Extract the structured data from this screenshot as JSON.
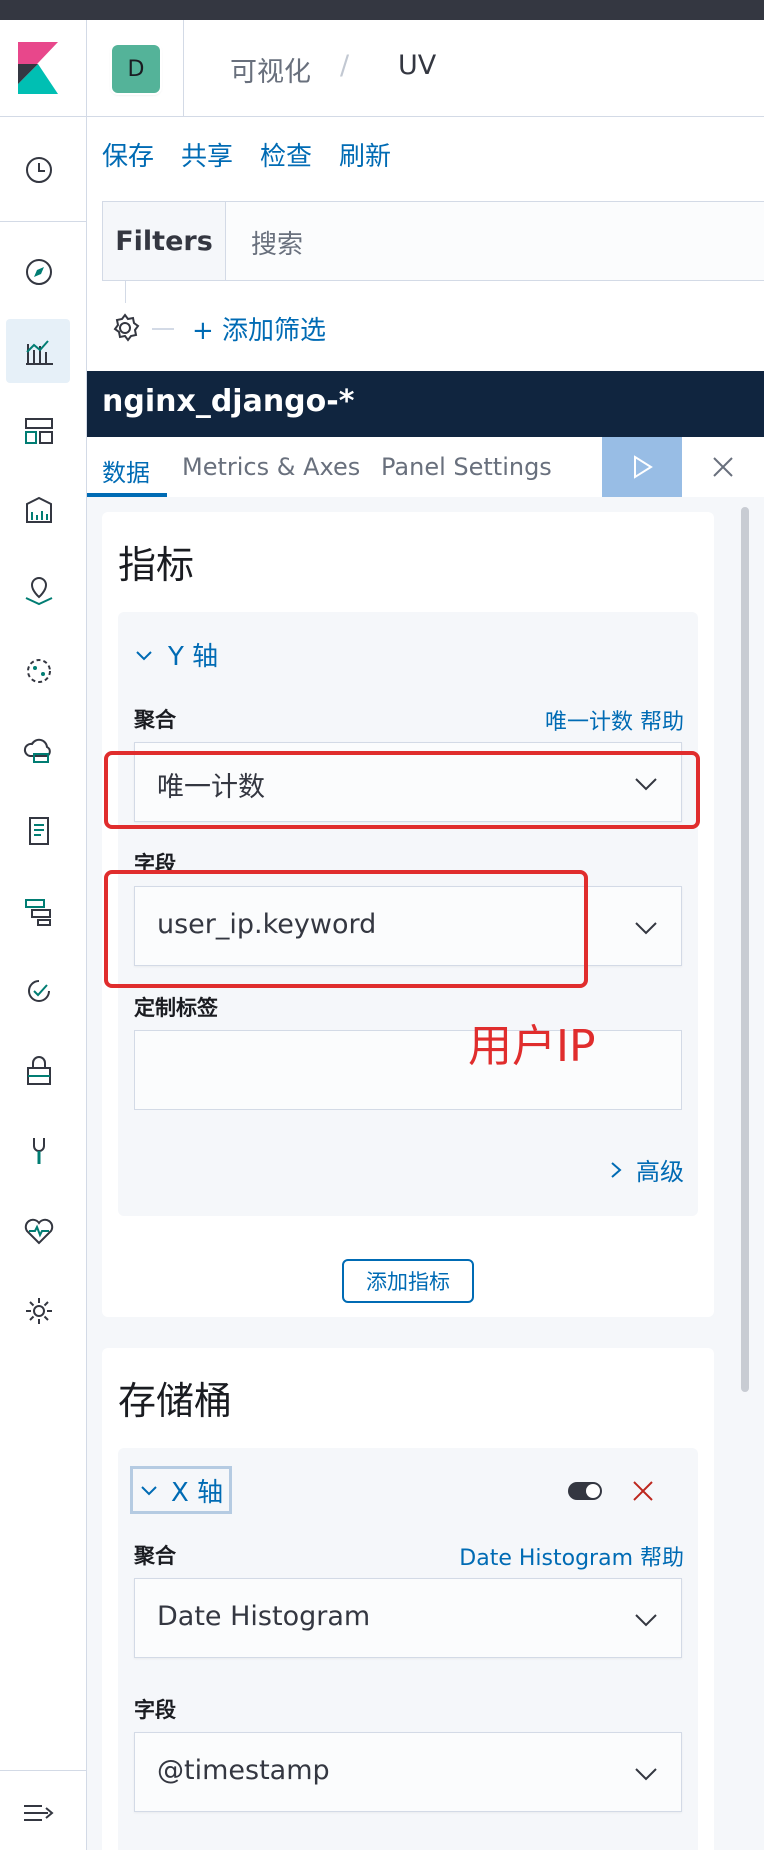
{
  "breadcrumbs": {
    "parent": "可视化",
    "separator": "/",
    "current": "UV"
  },
  "user": {
    "avatar_initial": "D"
  },
  "colors": {
    "accent": "#006bb4",
    "header_bg": "#10253f",
    "annotation": "#e02d2d",
    "avatar": "#54b399"
  },
  "actions": [
    "保存",
    "共享",
    "检查",
    "刷新"
  ],
  "query": {
    "filters_label": "Filters",
    "search_placeholder": "搜索",
    "add_filter": "+ 添加筛选"
  },
  "panel": {
    "index_pattern": "nginx_django-*",
    "tabs": [
      "数据",
      "Metrics & Axes",
      "Panel Settings"
    ],
    "active_tab": "数据"
  },
  "metrics": {
    "title": "指标",
    "y_axis": {
      "label": "Y 轴",
      "aggregation_label": "聚合",
      "aggregation_help": "唯一计数 帮助",
      "aggregation_value": "唯一计数",
      "field_label": "字段",
      "field_value": "user_ip.keyword",
      "custom_label": "定制标签",
      "custom_label_value": "",
      "advanced": "高级"
    },
    "add_button": "添加指标"
  },
  "buckets": {
    "title": "存储桶",
    "x_axis": {
      "label": "X 轴",
      "aggregation_label": "聚合",
      "aggregation_help": "Date Histogram 帮助",
      "aggregation_value": "Date Histogram",
      "field_label": "字段",
      "field_value": "@timestamp"
    }
  },
  "annotation": {
    "text": "用户IP"
  },
  "nav_icons": [
    "clock-icon",
    "compass-icon",
    "visualize-icon",
    "dashboard-icon",
    "canvas-icon",
    "maps-icon",
    "ml-icon",
    "infra-icon",
    "logs-icon",
    "apm-icon",
    "uptime-icon",
    "siem-icon",
    "dev-tools-icon",
    "monitoring-icon",
    "management-icon"
  ]
}
